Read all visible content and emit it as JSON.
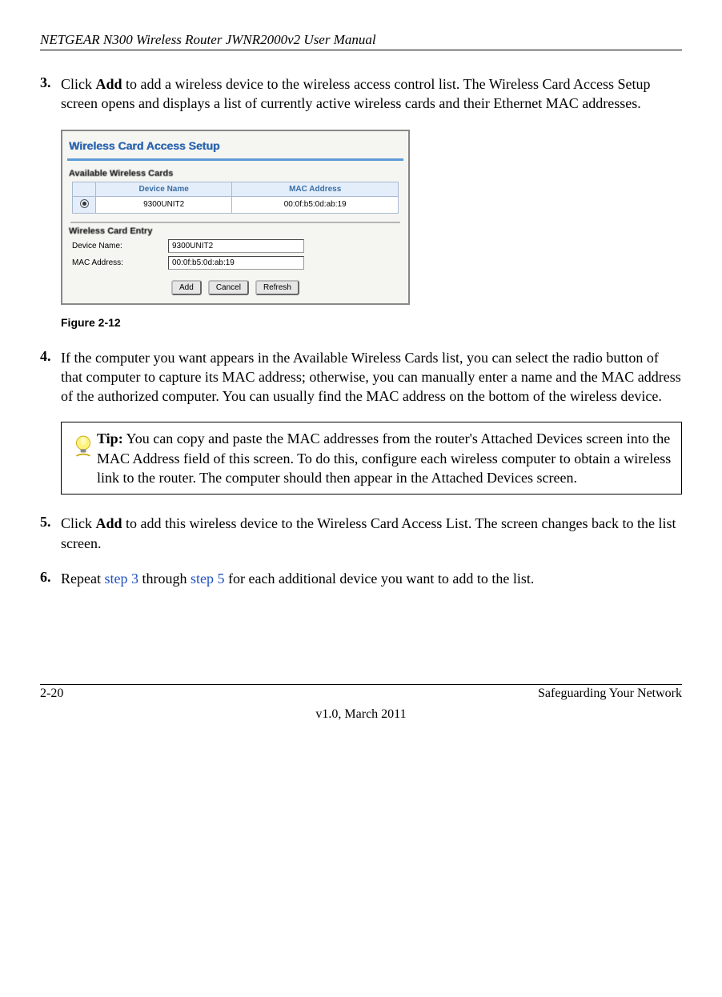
{
  "header": {
    "title": "NETGEAR N300 Wireless Router JWNR2000v2 User Manual"
  },
  "steps": {
    "s3": {
      "num": "3.",
      "pre": "Click ",
      "bold": "Add",
      "post": " to add a wireless device to the wireless access control list. The Wireless Card Access Setup screen opens and displays a list of currently active wireless cards and their Ethernet MAC addresses."
    },
    "s4": {
      "num": "4.",
      "text": "If the computer you want appears in the Available Wireless Cards list, you can select the radio button of that computer to capture its MAC address; otherwise, you can manually enter a name and the MAC address of the authorized computer. You can usually find the MAC address on the bottom of the wireless device."
    },
    "s5": {
      "num": "5.",
      "pre": "Click ",
      "bold": "Add",
      "post": " to add this wireless device to the Wireless Card Access List. The screen changes back to the list screen."
    },
    "s6": {
      "num": "6.",
      "pre": "Repeat ",
      "link1": "step 3",
      "mid": " through ",
      "link2": "step 5",
      "post": " for each additional device you want to add to the list."
    }
  },
  "screenshot": {
    "title": "Wireless Card Access Setup",
    "available_label": "Available Wireless Cards",
    "table_headers": {
      "h1": "Device Name",
      "h2": "MAC Address"
    },
    "row": {
      "device": "9300UNIT2",
      "mac": "00:0f:b5:0d:ab:19"
    },
    "entry_label": "Wireless Card Entry",
    "entry": {
      "device_label": "Device Name:",
      "device_value": "9300UNIT2",
      "mac_label": "MAC Address:",
      "mac_value": "00:0f:b5:0d:ab:19"
    },
    "buttons": {
      "add": "Add",
      "cancel": "Cancel",
      "refresh": "Refresh"
    }
  },
  "figure_caption": "Figure 2-12",
  "tip": {
    "label": "Tip:",
    "text": " You can copy and paste the MAC addresses from the router's Attached Devices screen into the MAC Address field of this screen. To do this, configure each wireless computer to obtain a wireless link to the router. The computer should then appear in the Attached Devices screen."
  },
  "footer": {
    "left": "2-20",
    "right": "Safeguarding Your Network",
    "version": "v1.0, March 2011"
  }
}
